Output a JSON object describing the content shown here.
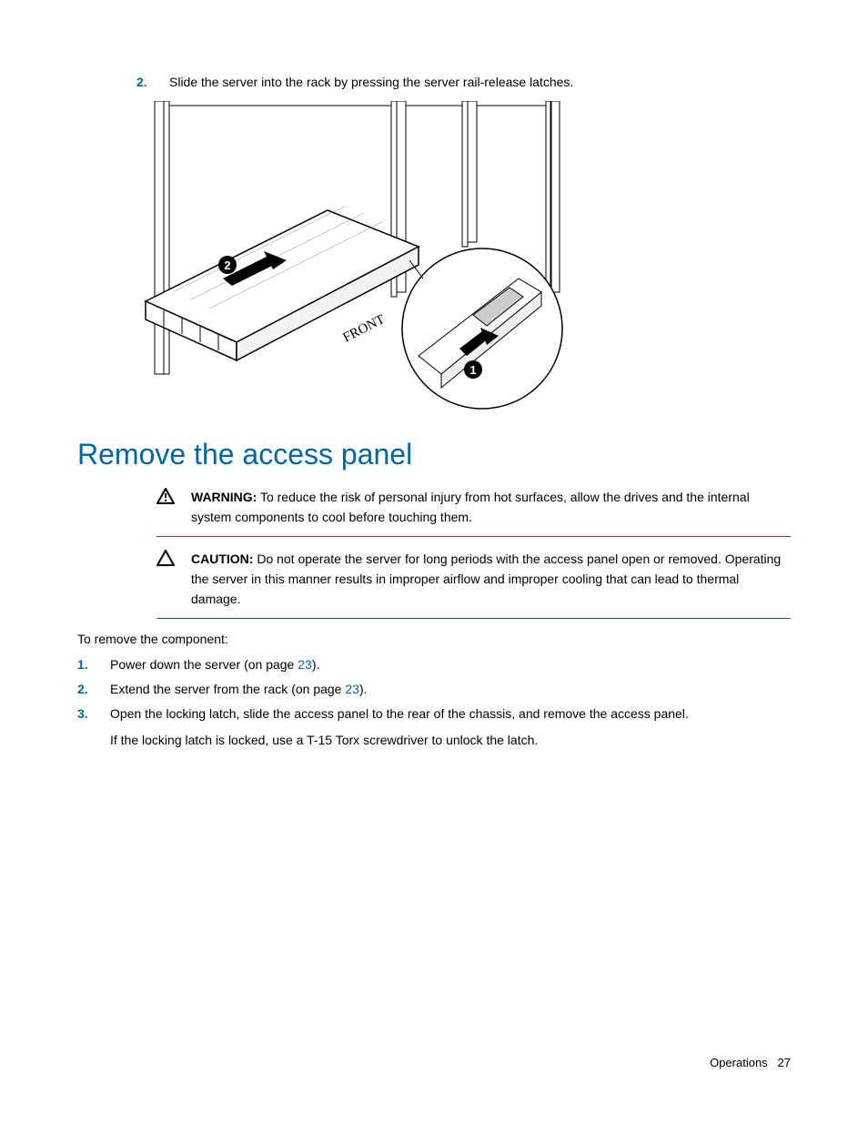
{
  "top_list": {
    "num": "2.",
    "text": "Slide the server into the rack by pressing the server rail-release latches."
  },
  "heading": "Remove the access panel",
  "warning": {
    "label": "WARNING:",
    "text": "To reduce the risk of personal injury from hot surfaces, allow the drives and the internal system components to cool before touching them."
  },
  "caution": {
    "label": "CAUTION:",
    "text": "Do not operate the server for long periods with the access panel open or removed. Operating the server in this manner results in improper airflow and improper cooling that can lead to thermal damage."
  },
  "intro": "To remove the component:",
  "steps": [
    {
      "num": "1.",
      "pre": "Power down the server (on page ",
      "link": "23",
      "post": ")."
    },
    {
      "num": "2.",
      "pre": "Extend the server from the rack (on page ",
      "link": "23",
      "post": ")."
    },
    {
      "num": "3.",
      "pre": "Open the locking latch, slide the access panel to the rear of the chassis, and remove the access panel.",
      "link": "",
      "post": ""
    }
  ],
  "step3_note": "If the locking latch is locked, use a T-15 Torx screwdriver to unlock the latch.",
  "footer_section": "Operations",
  "footer_page": "27",
  "figure_label_front": "FRONT"
}
